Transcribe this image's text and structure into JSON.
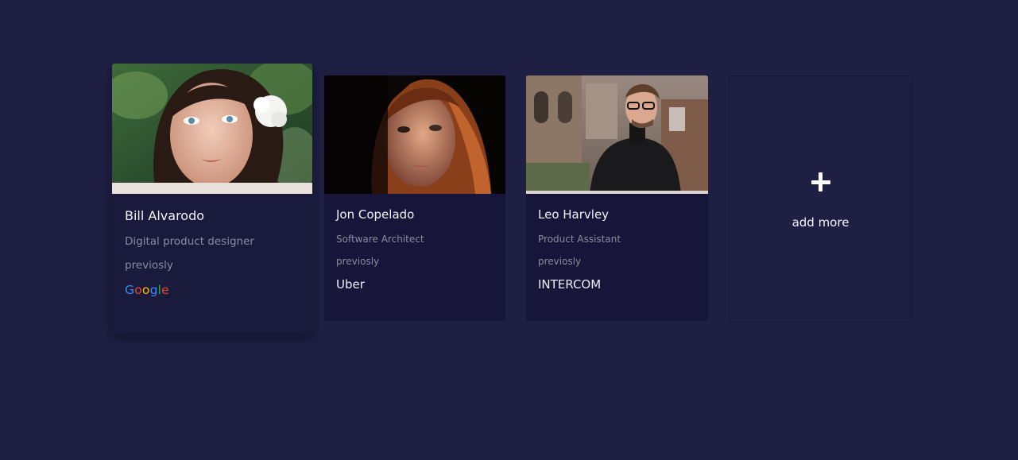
{
  "profiles": [
    {
      "name": "Bill Alvarodo",
      "role": "Digital product designer",
      "previously_label": "previosly",
      "company_letters": [
        "G",
        "o",
        "o",
        "g",
        "l",
        "e"
      ],
      "photo": "woman-with-white-flower-photo"
    },
    {
      "name": "Jon Copelado",
      "role": "Software Architect",
      "previously_label": "previosly",
      "company": "Uber",
      "photo": "red-haired-woman-photo"
    },
    {
      "name": "Leo Harvley",
      "role": "Product Assistant",
      "previously_label": "previosly",
      "company": "INTERCOM",
      "photo": "man-with-glasses-photo"
    }
  ],
  "add_card": {
    "icon": "plus-icon",
    "label": "add more"
  },
  "colors": {
    "background": "#1e1f42",
    "card": "#17163a",
    "muted_text": "#8a8aa0",
    "google_blue": "#4285f4",
    "google_red": "#ea4335",
    "google_yellow": "#fbbc05",
    "google_green": "#34a853"
  }
}
